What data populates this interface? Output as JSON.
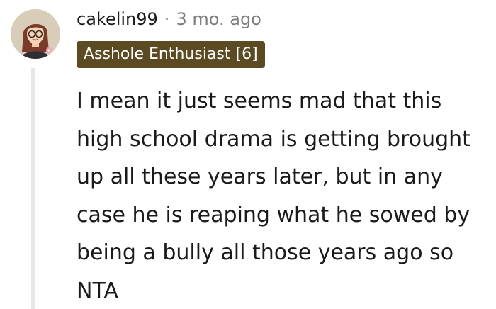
{
  "comment": {
    "author": "cakelin99",
    "separator": "·",
    "timestamp": "3 mo. ago",
    "flair": "Asshole Enthusiast [6]",
    "body": "I mean it just seems mad that this high school drama is getting brought up all these years later, but in any case he is reaping what he sowed by being a bully all those years ago so NTA",
    "avatar_icon": "user-avatar-icon"
  },
  "colors": {
    "flair_background": "#5c4a22",
    "flair_text": "#ffffff",
    "timestamp_text": "#7c7c7c",
    "thread_line": "#e6e7e8"
  }
}
